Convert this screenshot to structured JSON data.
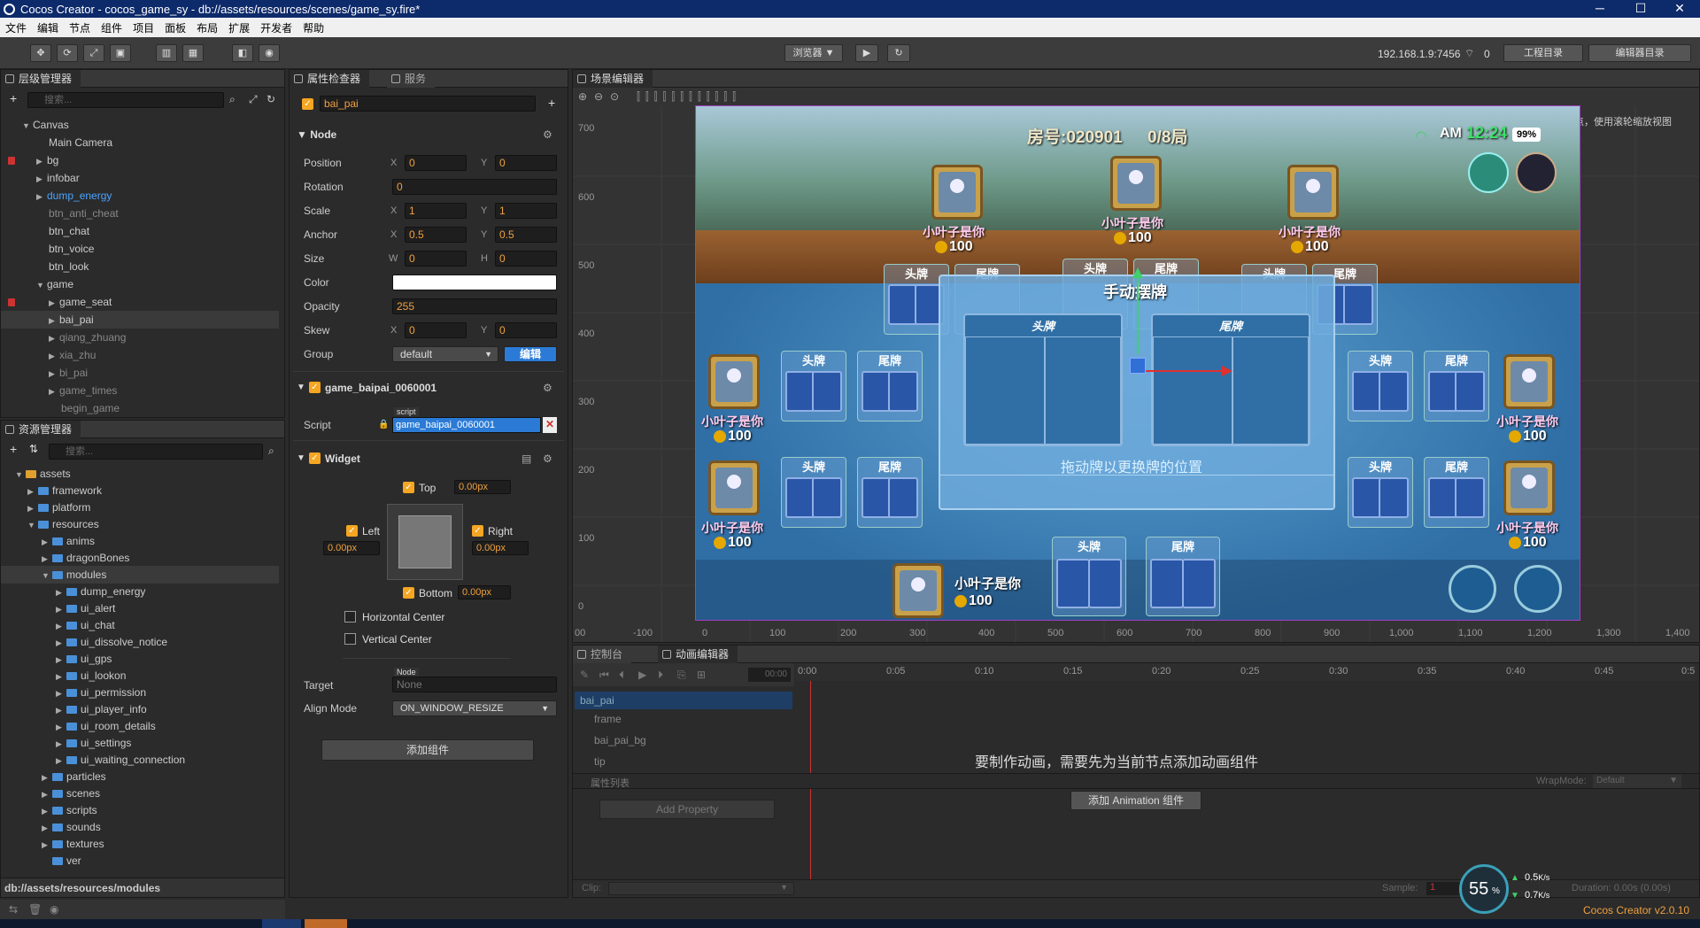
{
  "window": {
    "title": "Cocos Creator - cocos_game_sy - db://assets/resources/scenes/game_sy.fire*"
  },
  "menu": [
    "文件",
    "编辑",
    "节点",
    "组件",
    "项目",
    "面板",
    "布局",
    "扩展",
    "开发者",
    "帮助"
  ],
  "toolbar": {
    "preview_label": "浏览器 ▼",
    "ip": "192.168.1.9:7456",
    "wifi_count": "0",
    "project_dir": "工程目录",
    "editor_dir": "编辑器目录"
  },
  "hierarchy": {
    "title": "层级管理器",
    "search_placeholder": "搜索...",
    "items": [
      {
        "label": "Canvas"
      },
      {
        "label": "Main Camera"
      },
      {
        "label": "bg"
      },
      {
        "label": "infobar"
      },
      {
        "label": "dump_energy"
      },
      {
        "label": "btn_anti_cheat"
      },
      {
        "label": "btn_chat"
      },
      {
        "label": "btn_voice"
      },
      {
        "label": "btn_look"
      },
      {
        "label": "game"
      },
      {
        "label": "game_seat"
      },
      {
        "label": "bai_pai"
      },
      {
        "label": "qiang_zhuang"
      },
      {
        "label": "xia_zhu"
      },
      {
        "label": "bi_pai"
      },
      {
        "label": "game_times"
      },
      {
        "label": "begin_game"
      }
    ]
  },
  "assets": {
    "title": "资源管理器",
    "search_placeholder": "搜索...",
    "items": [
      {
        "label": "assets"
      },
      {
        "label": "framework"
      },
      {
        "label": "platform"
      },
      {
        "label": "resources"
      },
      {
        "label": "anims"
      },
      {
        "label": "dragonBones"
      },
      {
        "label": "modules"
      },
      {
        "label": "dump_energy"
      },
      {
        "label": "ui_alert"
      },
      {
        "label": "ui_chat"
      },
      {
        "label": "ui_dissolve_notice"
      },
      {
        "label": "ui_gps"
      },
      {
        "label": "ui_lookon"
      },
      {
        "label": "ui_permission"
      },
      {
        "label": "ui_player_info"
      },
      {
        "label": "ui_room_details"
      },
      {
        "label": "ui_settings"
      },
      {
        "label": "ui_waiting_connection"
      },
      {
        "label": "particles"
      },
      {
        "label": "scenes"
      },
      {
        "label": "scripts"
      },
      {
        "label": "sounds"
      },
      {
        "label": "textures"
      },
      {
        "label": "ver"
      }
    ],
    "path": "db://assets/resources/modules"
  },
  "inspector": {
    "tab_inspector": "属性检查器",
    "tab_service": "服务",
    "node_name": "bai_pai",
    "node_section": "Node",
    "position": {
      "label": "Position",
      "x": "0",
      "y": "0"
    },
    "rotation": {
      "label": "Rotation",
      "value": "0"
    },
    "scale": {
      "label": "Scale",
      "x": "1",
      "y": "1"
    },
    "anchor": {
      "label": "Anchor",
      "x": "0.5",
      "y": "0.5"
    },
    "size": {
      "label": "Size",
      "w": "0",
      "h": "0"
    },
    "color": {
      "label": "Color"
    },
    "opacity": {
      "label": "Opacity",
      "value": "255"
    },
    "skew": {
      "label": "Skew",
      "x": "0",
      "y": "0"
    },
    "group": {
      "label": "Group",
      "value": "default",
      "edit": "编辑"
    },
    "script_section": "game_baipai_0060001",
    "script": {
      "label": "Script",
      "tag": "script",
      "value": "game_baipai_0060001"
    },
    "widget_section": "Widget",
    "widget": {
      "top": "Top",
      "top_val": "0.00px",
      "left": "Left",
      "left_val": "0.00px",
      "right": "Right",
      "right_val": "0.00px",
      "bottom": "Bottom",
      "bottom_val": "0.00px",
      "hcenter": "Horizontal Center",
      "vcenter": "Vertical Center"
    },
    "target": {
      "label": "Target",
      "tag": "Node",
      "value": "None"
    },
    "align_mode": {
      "label": "Align Mode",
      "value": "ON_WINDOW_RESIZE"
    },
    "add_component": "添加组件"
  },
  "scene": {
    "title": "场景编辑器",
    "hint": "使用鼠标右键平移视窗焦点，使用滚轮缩放视图",
    "y_ticks": [
      "700",
      "600",
      "500",
      "400",
      "300",
      "200",
      "100",
      "0"
    ],
    "x_ticks": [
      "00",
      "-100",
      "0",
      "100",
      "200",
      "300",
      "400",
      "500",
      "600",
      "700",
      "800",
      "900",
      "1,000",
      "1,100",
      "1,200",
      "1,300",
      "1,400"
    ],
    "game": {
      "room": "房号:020901",
      "round": "0/8局",
      "time_prefix": "AM",
      "time": "12:24",
      "battery": "99%",
      "player_name": "小叶子是你",
      "score": "100",
      "head": "头牌",
      "tail": "尾牌",
      "dialog_title": "手动摆牌",
      "dialog_head": "头牌",
      "dialog_tail": "尾牌",
      "dialog_hint": "拖动牌以更换牌的位置"
    }
  },
  "console_tab": "控制台",
  "anim": {
    "tab": "动画编辑器",
    "time_field": "00:00",
    "ticks": [
      "0:00",
      "0:05",
      "0:10",
      "0:15",
      "0:20",
      "0:25",
      "0:30",
      "0:35",
      "0:40",
      "0:45",
      "0:5"
    ],
    "nodes": [
      "bai_pai",
      "frame",
      "bai_pai_bg",
      "tip"
    ],
    "props_label": "属性列表",
    "wrapmode_label": "WrapMode:",
    "wrapmode_value": "Default",
    "add_property": "Add Property",
    "notice": "要制作动画，需要先为当前节点添加动画组件",
    "add_anim": "添加 Animation 组件",
    "clip_label": "Clip:",
    "sample_label": "Sample:",
    "sample_value": "1",
    "duration": "Duration: 0.00s (0.00s)"
  },
  "status": {
    "version": "Cocos Creator v2.0.10",
    "cpu": "55",
    "cpu_unit": "%",
    "up": "0.5",
    "down": "0.7",
    "rate_unit": "K/s"
  }
}
